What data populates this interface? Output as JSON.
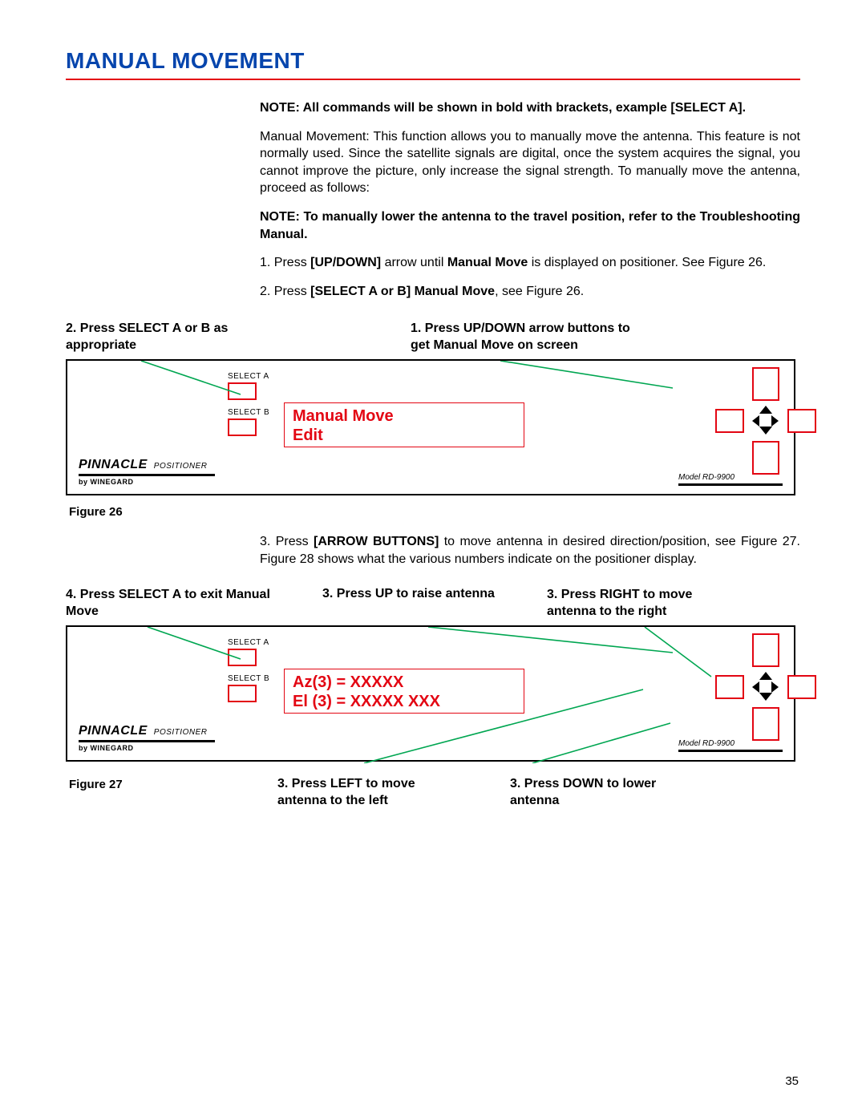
{
  "heading": "MANUAL MOVEMENT",
  "note1_prefix": "NOTE:  All commands will be shown in bold with brackets, example ",
  "note1_cmd": "[SELECT A]",
  "note1_suffix": ".",
  "para1": "Manual Movement:  This function allows you to manually move the antenna. This feature is not normally used.  Since the satellite signals are digital, once the system acquires the signal, you cannot improve the picture, only increase the signal strength. To manually move the antenna, proceed as follows:",
  "note2": "NOTE:  To manually lower the antenna to the travel position, refer to the Troubleshooting Manual.",
  "step1_a": "1.   Press ",
  "step1_b": "[UP/DOWN]",
  "step1_c": " arrow until ",
  "step1_d": "Manual Move",
  "step1_e": " is displayed on positioner. See Figure 26.",
  "step2_a": "2.   Press ",
  "step2_b": "[SELECT A or B] Manual Move",
  "step2_c": ", see Figure 26.",
  "callout_left1": "2. Press SELECT A or B as appropriate",
  "callout_right1": "1.   Press UP/DOWN arrow buttons to get Manual Move on screen",
  "device": {
    "selectA": "SELECT A",
    "selectB": "SELECT B",
    "brand": "PINNACLE",
    "positioner": "POSITIONER",
    "by": "by WINEGARD",
    "model": "Model RD-9900"
  },
  "lcd1_line1": "Manual Move",
  "lcd1_line2": "Edit",
  "fig26": "Figure 26",
  "step3_a": "3.   Press ",
  "step3_b": "[ARROW BUTTONS]",
  "step3_c": "  to move antenna in desired direction/position, see Figure 27.  Figure 28 shows what the various numbers indicate on the positioner display.",
  "callout2a": "4. Press SELECT A to exit Manual Move",
  "callout2b": "3. Press UP to raise antenna",
  "callout2c": "3.   Press RIGHT to move  antenna to the right",
  "lcd2_line1": "Az(3) = XXXXX",
  "lcd2_line2": "El (3) = XXXXX    XXX",
  "fig27": "Figure 27",
  "callout3a": "3.   Press LEFT to move  antenna to the left",
  "callout3b": "3.   Press DOWN to lower antenna",
  "page_number": "35"
}
